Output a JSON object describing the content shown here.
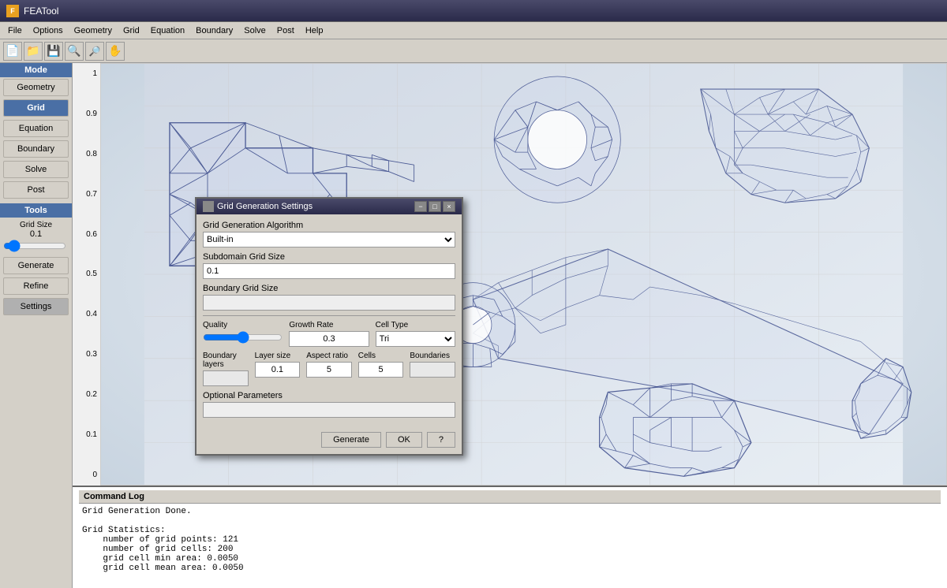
{
  "app": {
    "title": "FEATool",
    "title_icon": "F"
  },
  "menu": {
    "items": [
      "File",
      "Options",
      "Geometry",
      "Grid",
      "Equation",
      "Boundary",
      "Solve",
      "Post",
      "Help"
    ]
  },
  "toolbar": {
    "buttons": [
      "📄",
      "📁",
      "💾",
      "🔍",
      "🔍",
      "✋"
    ]
  },
  "sidebar": {
    "mode_label": "Mode",
    "items": [
      "Geometry",
      "Grid",
      "Equation",
      "Boundary",
      "Solve",
      "Post"
    ],
    "active": "Grid",
    "tools_label": "Tools",
    "grid_size_label": "Grid Size",
    "grid_size_value": "0.1",
    "generate_label": "Generate",
    "refine_label": "Refine",
    "settings_label": "Settings"
  },
  "y_axis": {
    "labels": [
      "1",
      "0.9",
      "0.8",
      "0.7",
      "0.6",
      "0.5",
      "0.4",
      "0.3",
      "0.2",
      "0.1",
      "0"
    ]
  },
  "dialog": {
    "title": "Grid Generation Settings",
    "min_btn": "−",
    "max_btn": "□",
    "close_btn": "×",
    "algorithm_label": "Grid Generation Algorithm",
    "algorithm_value": "Built-in",
    "subdomain_label": "Subdomain Grid Size",
    "subdomain_value": "0.1",
    "boundary_label": "Boundary Grid Size",
    "quality_label": "Quality",
    "quality_value": "1",
    "growth_rate_label": "Growth Rate",
    "growth_rate_value": "0.3",
    "cell_type_label": "Cell Type",
    "cell_type_value": "Tri",
    "boundary_layers_label": "Boundary layers",
    "layer_size_label": "Layer size",
    "layer_size_value": "0.1",
    "aspect_ratio_label": "Aspect ratio",
    "cells_label": "Cells",
    "cells_value": "5",
    "aspect_value": "5",
    "boundaries_label": "Boundaries",
    "optional_label": "Optional Parameters",
    "generate_btn": "Generate",
    "ok_btn": "OK",
    "help_btn": "?"
  },
  "command_log": {
    "title": "Command Log",
    "lines": [
      "Grid Generation Done.",
      "",
      "Grid Statistics:",
      "    number of grid points: 121",
      "    number of grid cells: 200",
      "    grid cell min area: 0.0050",
      "    grid cell mean area: 0.0050"
    ]
  },
  "colors": {
    "sidebar_bg": "#d4d0c8",
    "active_btn": "#4a6fa5",
    "mesh_color": "#3a4a8a",
    "bg_mesh": "#c8d8e8"
  }
}
